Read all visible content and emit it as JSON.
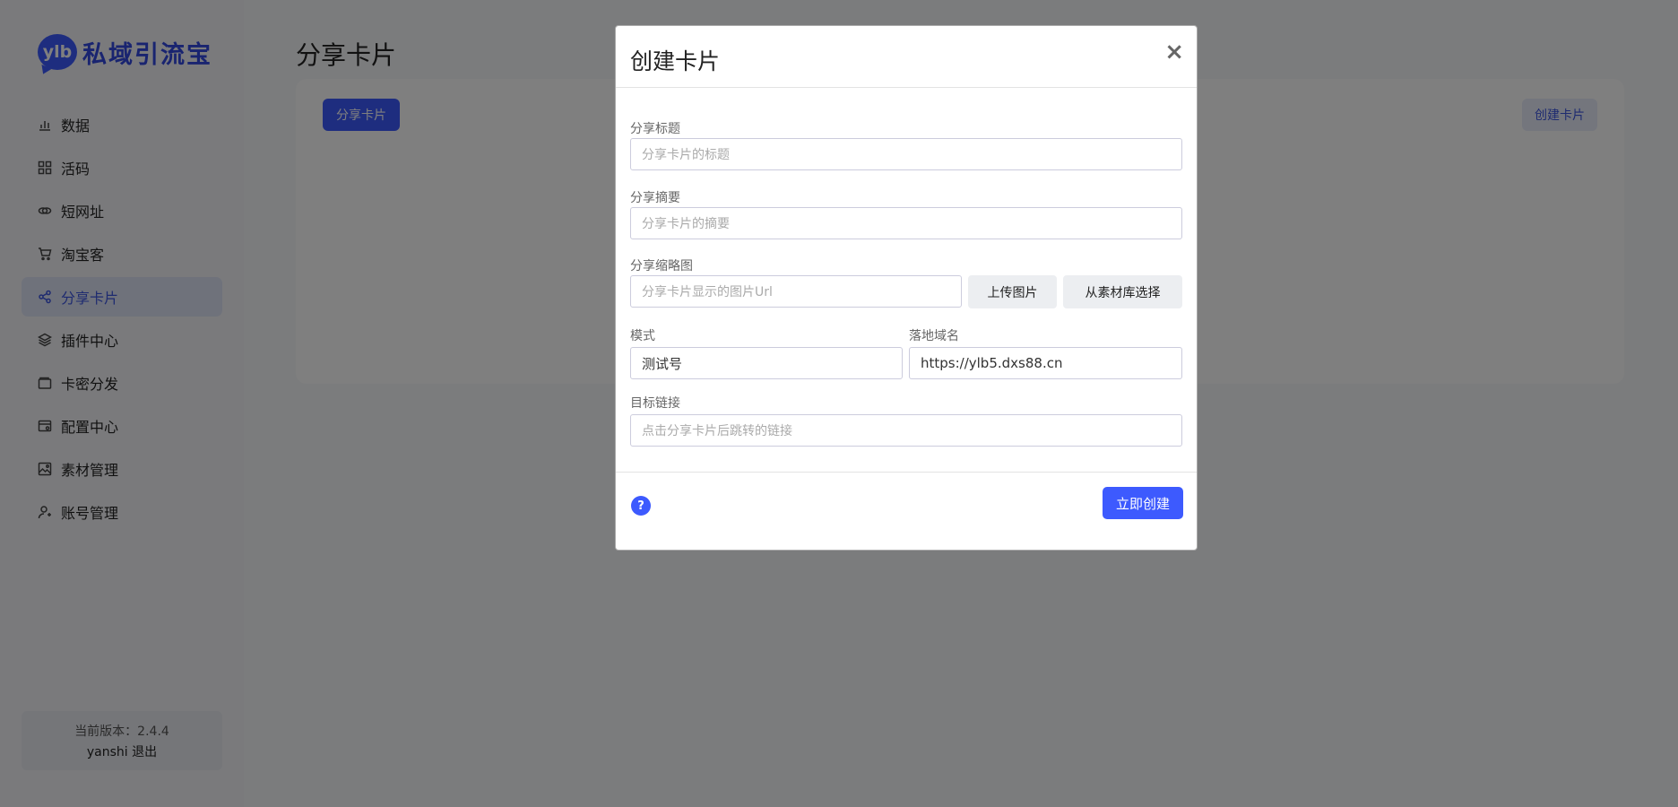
{
  "sidebar": {
    "logo_badge": "ylb",
    "logo_text": "私域引流宝",
    "items": [
      {
        "label": "数据",
        "icon": "bar-chart-icon"
      },
      {
        "label": "活码",
        "icon": "grid-icon"
      },
      {
        "label": "短网址",
        "icon": "link-icon"
      },
      {
        "label": "淘宝客",
        "icon": "cart-icon"
      },
      {
        "label": "分享卡片",
        "icon": "share-icon",
        "active": true
      },
      {
        "label": "插件中心",
        "icon": "layers-icon"
      },
      {
        "label": "卡密分发",
        "icon": "wallet-icon"
      },
      {
        "label": "配置中心",
        "icon": "config-icon"
      },
      {
        "label": "素材管理",
        "icon": "image-icon"
      },
      {
        "label": "账号管理",
        "icon": "user-icon"
      }
    ],
    "version_text": "当前版本：2.4.4",
    "user_text": "yanshi 退出"
  },
  "main": {
    "page_title": "分享卡片",
    "tab_label": "分享卡片",
    "create_button": "创建卡片"
  },
  "modal": {
    "title": "创建卡片",
    "close": "×",
    "share_title_label": "分享标题",
    "share_title_placeholder": "分享卡片的标题",
    "share_summary_label": "分享摘要",
    "share_summary_placeholder": "分享卡片的摘要",
    "thumbnail_label": "分享缩略图",
    "thumbnail_placeholder": "分享卡片显示的图片Url",
    "upload_button": "上传图片",
    "library_button": "从素材库选择",
    "mode_label": "模式",
    "mode_value": "测试号",
    "domain_label": "落地域名",
    "domain_value": "https://ylb5.dxs88.cn",
    "target_label": "目标链接",
    "target_placeholder": "点击分享卡片后跳转的链接",
    "help": "?",
    "submit_button": "立即创建"
  },
  "colors": {
    "accent": "#3d5afe",
    "overlay": "rgba(0,0,0,0.5)"
  }
}
